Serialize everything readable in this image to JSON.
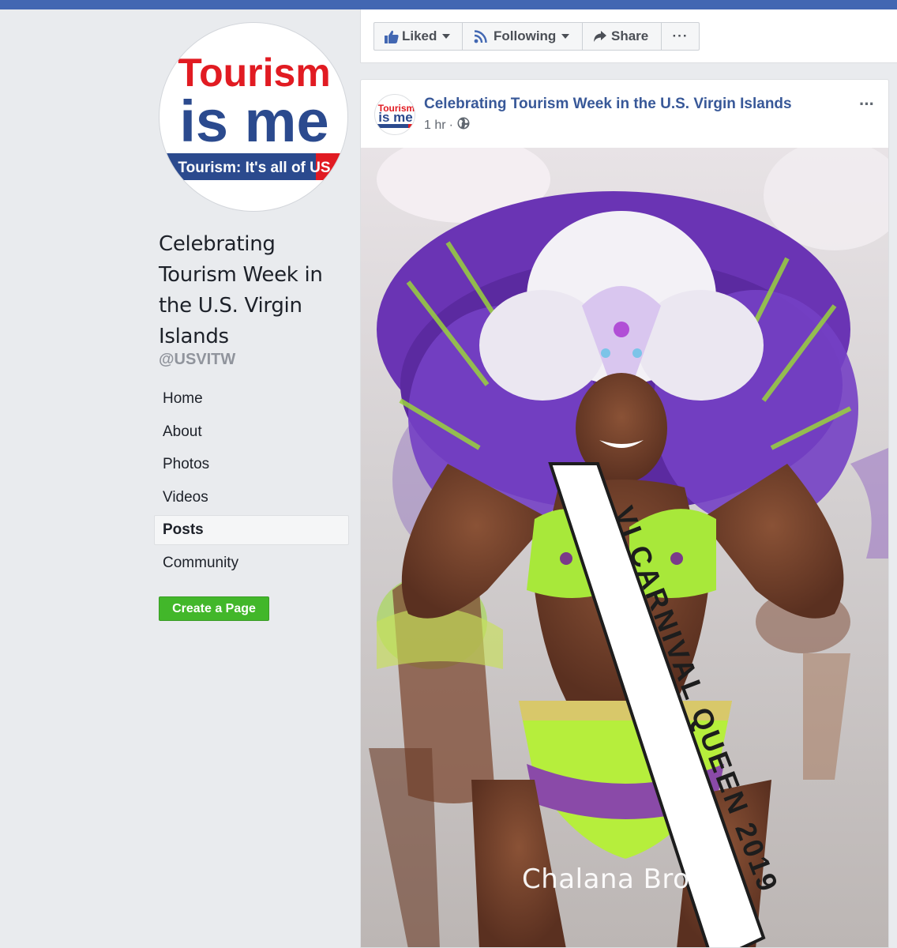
{
  "page": {
    "logo": {
      "line1": "Tourism",
      "line2": "is me",
      "tagline": "Tourism: It's all of US"
    },
    "name": "Celebrating Tourism Week in the U.S. Virgin Islands",
    "handle": "@USVITW"
  },
  "sidebar": {
    "items": [
      {
        "label": "Home",
        "active": false
      },
      {
        "label": "About",
        "active": false
      },
      {
        "label": "Photos",
        "active": false
      },
      {
        "label": "Videos",
        "active": false
      },
      {
        "label": "Posts",
        "active": true
      },
      {
        "label": "Community",
        "active": false
      }
    ],
    "create_page_label": "Create a Page"
  },
  "actions": {
    "liked_label": "Liked",
    "following_label": "Following",
    "share_label": "Share",
    "more_label": "···"
  },
  "post": {
    "author": "Celebrating Tourism Week in the U.S. Virgin Islands",
    "time": "1 hr",
    "separator": "·",
    "audience_icon": "globe-icon",
    "menu_label": "···",
    "photo": {
      "description_icon": "carnival-photo",
      "credit": "Chalana Brown",
      "sash_text": "VI CARNIVAL QUEEN 2019"
    }
  },
  "colors": {
    "facebook_blue": "#4267b2",
    "link_blue": "#385898",
    "create_green": "#42b72a",
    "logo_red": "#e11b22",
    "logo_blue": "#2b4a8e"
  }
}
